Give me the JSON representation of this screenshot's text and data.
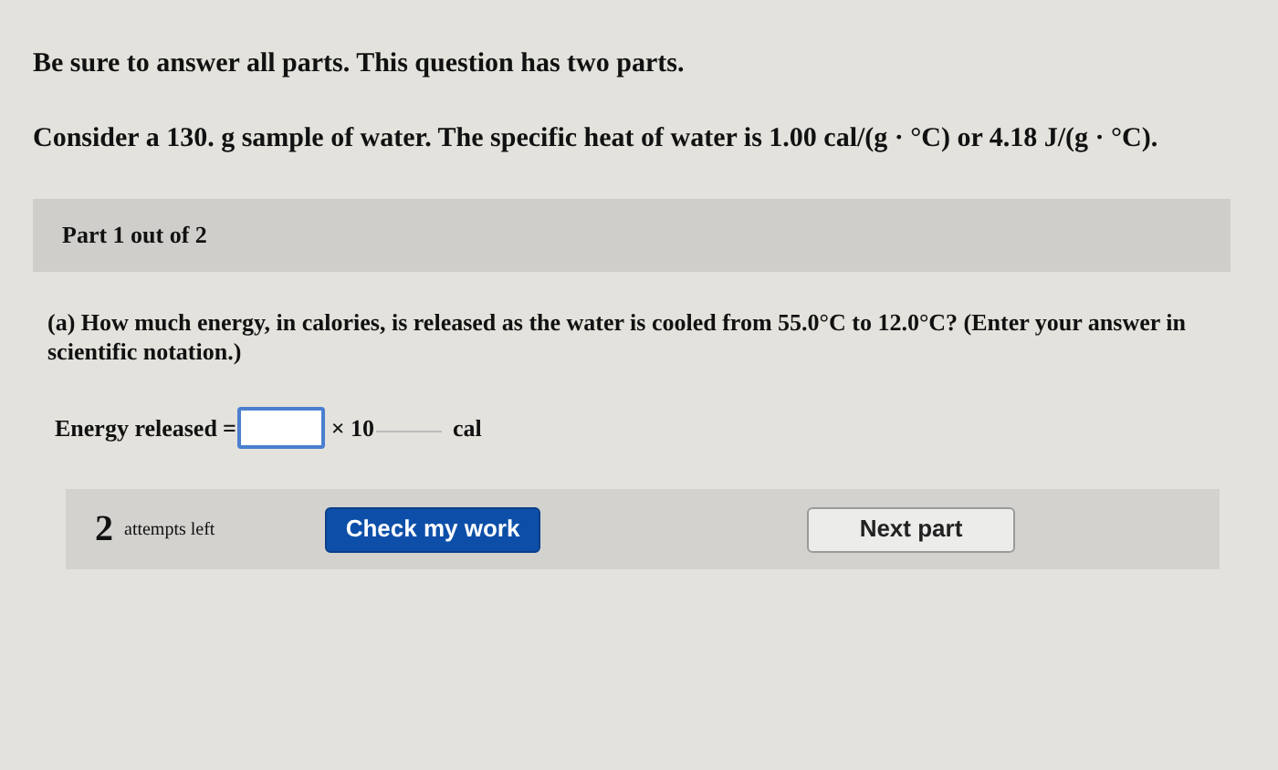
{
  "instructions": "Be sure to answer all parts. This question has two parts.",
  "problem": "Consider a 130. g sample of water. The specific heat of water is 1.00 cal/(g · °C) or 4.18 J/(g · °C).",
  "part_header": "Part 1 out of 2",
  "question": "(a) How much energy, in calories, is released as the water is cooled from 55.0°C to 12.0°C? (Enter your answer in scientific notation.)",
  "answer": {
    "label": "Energy released",
    "equals": "=",
    "times": "× 10",
    "unit": "cal"
  },
  "footer": {
    "attempts_count": "2",
    "attempts_text": "attempts left",
    "buttons": [
      {
        "label": "Check my work",
        "kind": "primary"
      },
      {
        "label": "Next part",
        "kind": "secondary"
      }
    ]
  }
}
